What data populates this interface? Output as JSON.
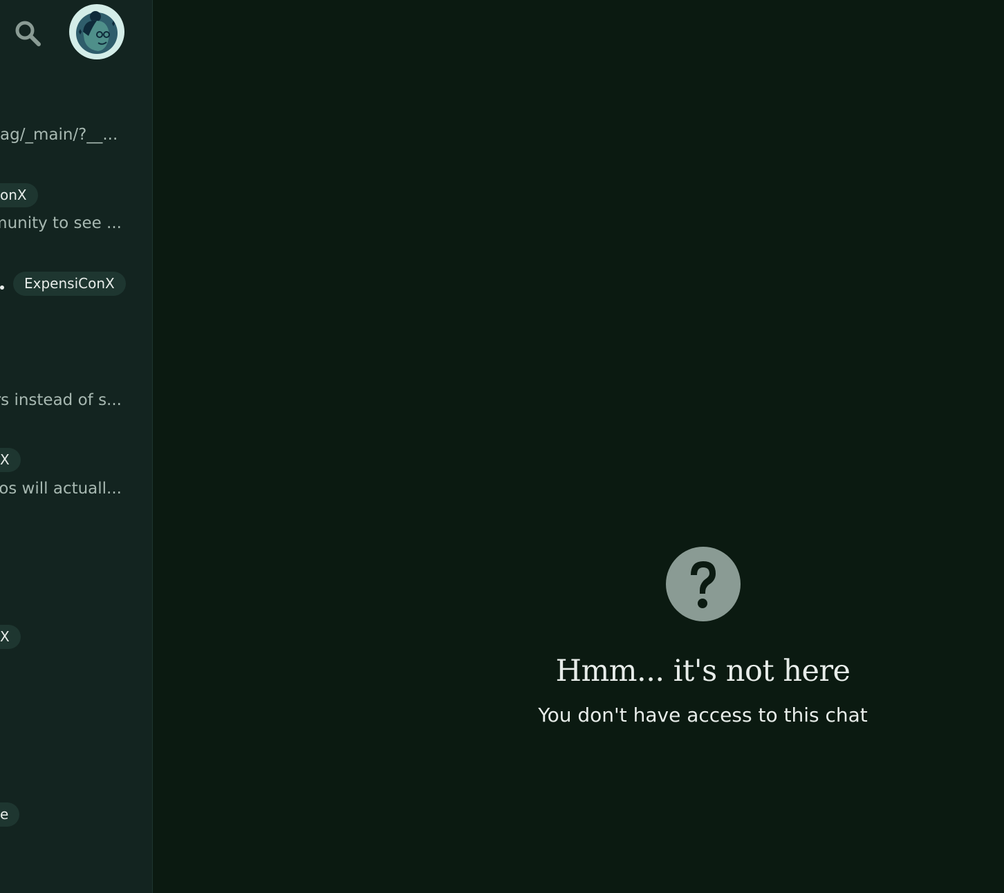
{
  "sidebar": {
    "search_icon": "search-icon",
    "avatar_icon": "user-avatar-cartoon",
    "rows": [
      {
        "text": "ag/_main/?__..."
      },
      {
        "pill": "onX"
      },
      {
        "text": "munity to see ..."
      },
      {
        "pill": "ExpensiConX"
      },
      {
        "text": "rs instead of s..."
      },
      {
        "pill": "X"
      },
      {
        "text": "os will actuall..."
      },
      {
        "pill": "X"
      },
      {
        "pill": "e"
      }
    ]
  },
  "main": {
    "empty_icon": "question-mark-icon",
    "title": "Hmm... it's not here",
    "subtitle": "You don't have access to this chat"
  },
  "colors": {
    "app_bg": "#0b1a11",
    "sidebar_bg": "#132420",
    "icon_gray": "#8a9b94",
    "text_primary": "#e7ece9",
    "text_secondary": "#a7b8b1",
    "pill_bg": "#1e3630"
  }
}
